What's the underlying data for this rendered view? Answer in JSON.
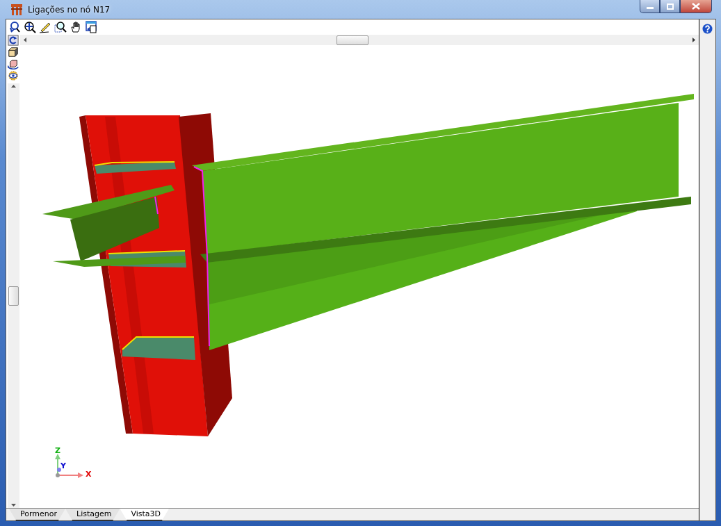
{
  "window": {
    "title": "Ligações no nó N17"
  },
  "axes": {
    "z": "Z",
    "y": "Y",
    "x": "X"
  },
  "tabs": [
    {
      "label": "Pormenor",
      "selected": false
    },
    {
      "label": "Listagem",
      "selected": false
    },
    {
      "label": "Vista3D",
      "selected": true
    }
  ]
}
